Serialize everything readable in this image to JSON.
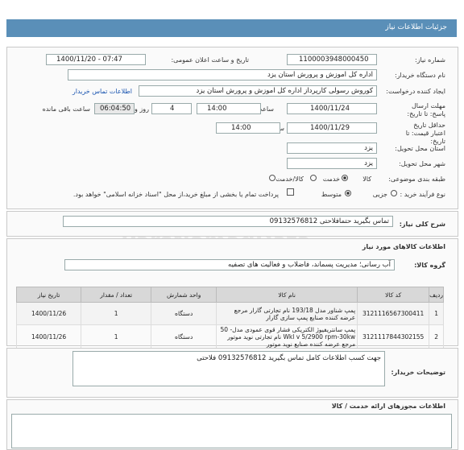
{
  "header": {
    "title": "جزئیات اطلاعات نیاز"
  },
  "fields": {
    "need_number_label": "شماره نیاز:",
    "need_number": "1100003948000450",
    "announce_label": "تاریخ و ساعت اعلان عمومی:",
    "announce_value": "1400/11/20 - 07:47",
    "buyer_label": "نام دستگاه خریدار:",
    "buyer": "اداره کل اموزش و پرورش استان یزد",
    "creator_label": "ایجاد کننده درخواست:",
    "creator": "کوروش رسولی کارپرداز اداره کل اموزش و پرورش استان یزد",
    "contact_link": "اطلاعات تماس خریدار",
    "deadline_label": "مهلت ارسال پاسخ: تا تاریخ:",
    "deadline_date": "1400/11/24",
    "time_label": "ساعت",
    "deadline_time": "14:00",
    "days": "4",
    "days_label": "روز و",
    "remain": "06:04:50",
    "remain_label": "ساعت باقی مانده",
    "validity_label": "حداقل تاریخ اعتبار قیمت: تا تاریخ:",
    "validity_date": "1400/11/29",
    "validity_time": "14:00",
    "province_label": "استان محل تحویل:",
    "province": "یزد",
    "city_label": "شهر محل تحویل:",
    "city": "یزد",
    "category_label": "طبقه بندی موضوعی:",
    "cat_goods": "کالا",
    "cat_service": "خدمت",
    "cat_both": "کالا/خدمت",
    "process_label": "نوع فرآیند خرید :",
    "proc_partial": "جزیی",
    "proc_medium": "متوسط",
    "payment_note": "پرداخت تمام یا بخشی از مبلغ خرید،از محل \"اسناد خزانه اسلامی\" خواهد بود."
  },
  "summary": {
    "label": "شرح کلی نیاز:",
    "value": "تماس بگیرید حتمافلاحتی 09132576812"
  },
  "goods": {
    "title": "اطلاعات کالاهای مورد نیاز",
    "group_label": "گروه کالا:",
    "group_value": "آب رسانی؛ مدیریت پسماند، فاضلاب و فعالیت های تصفیه",
    "columns": [
      "ردیف",
      "کد کالا",
      "نام کالا",
      "واحد شمارش",
      "تعداد / مقدار",
      "تاریخ نیاز"
    ],
    "rows": [
      {
        "n": "1",
        "code": "3121116567300411",
        "name": "پمپ شناور مدل 193/18 نام تجارتی گارار مرجع عرضه کننده صنایع پمپ سازی گارار",
        "unit": "دستگاه",
        "qty": "1",
        "date": "1400/11/26"
      },
      {
        "n": "2",
        "code": "3121117844302155",
        "name": "پمپ سانتریفیوژ الکتریکی فشار قوی عمودی مدل- 50 Wkl v 5/2900 rpm-30kw نام تجارتی نوید موتور مرجع عرضه کننده صنایع نوید موتور",
        "unit": "دستگاه",
        "qty": "1",
        "date": "1400/11/26"
      }
    ]
  },
  "buyer_notes": {
    "label": "توضیحات خریدار:",
    "value": "جهت کسب اطلاعات کامل تماس بگیرید 09132576812 فلاحتی"
  },
  "permits": {
    "title": "اطلاعات مجوزهای ارائه خدمت / کالا"
  },
  "watermark": {
    "text": "ParsNamadData",
    "sub": "پایگاه اطلاع رسانی مناقصات"
  }
}
